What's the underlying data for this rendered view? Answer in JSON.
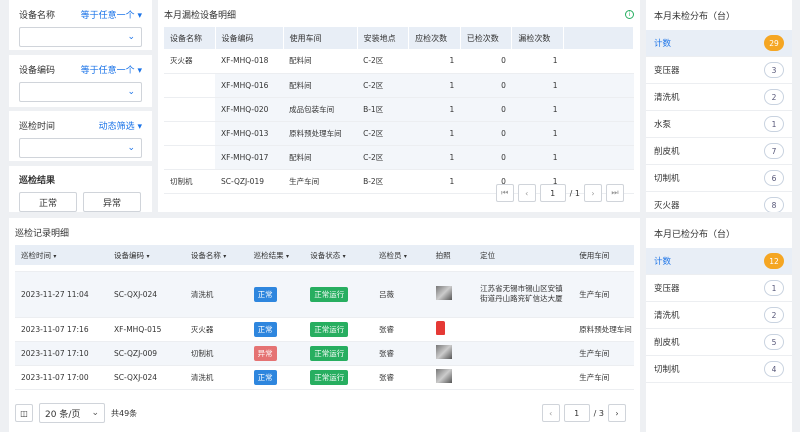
{
  "filters": {
    "equip_name": {
      "label": "设备名称",
      "mode": "等于任意一个"
    },
    "equip_code": {
      "label": "设备编码",
      "mode": "等于任意一个"
    },
    "inspect_time": {
      "label": "巡检时间",
      "mode": "动态筛选"
    },
    "result": {
      "label": "巡检结果",
      "normal": "正常",
      "abnormal": "异常"
    }
  },
  "missed": {
    "title": "本月漏检设备明细",
    "columns": [
      "设备名称",
      "设备编码",
      "使用车间",
      "安装地点",
      "应检次数",
      "已检次数",
      "漏检次数"
    ],
    "rows": [
      [
        "灭火器",
        "XF-MHQ-018",
        "配料间",
        "C-2区",
        "1",
        "0",
        "1"
      ],
      [
        "",
        "XF-MHQ-016",
        "配料间",
        "C-2区",
        "1",
        "0",
        "1"
      ],
      [
        "",
        "XF-MHQ-020",
        "成品包装车间",
        "B-1区",
        "1",
        "0",
        "1"
      ],
      [
        "",
        "XF-MHQ-013",
        "原料预处理车间",
        "C-2区",
        "1",
        "0",
        "1"
      ],
      [
        "",
        "XF-MHQ-017",
        "配料间",
        "C-2区",
        "1",
        "0",
        "1"
      ],
      [
        "切制机",
        "SC-QZJ-019",
        "生产车间",
        "B-2区",
        "1",
        "0",
        "1"
      ]
    ],
    "page": "1",
    "total_pages": "/ 1"
  },
  "unchecked": {
    "title": "本月未检分布（台）",
    "head": {
      "label": "计数",
      "value": "29"
    },
    "items": [
      {
        "label": "变压器",
        "value": "3"
      },
      {
        "label": "清洗机",
        "value": "2"
      },
      {
        "label": "水泵",
        "value": "1"
      },
      {
        "label": "削皮机",
        "value": "7"
      },
      {
        "label": "切制机",
        "value": "6"
      },
      {
        "label": "灭火器",
        "value": "8"
      }
    ]
  },
  "checked": {
    "title": "本月已检分布（台）",
    "head": {
      "label": "计数",
      "value": "12"
    },
    "items": [
      {
        "label": "变压器",
        "value": "1"
      },
      {
        "label": "清洗机",
        "value": "2"
      },
      {
        "label": "削皮机",
        "value": "5"
      },
      {
        "label": "切制机",
        "value": "4"
      }
    ]
  },
  "records": {
    "title": "巡检记录明细",
    "columns": [
      "巡检时间",
      "设备编码",
      "设备名称",
      "巡检结果",
      "设备状态",
      "巡检员",
      "拍照",
      "定位",
      "使用车间"
    ],
    "rows": [
      {
        "time": "2023-11-27 11:04",
        "code": "SC-QXJ-024",
        "name": "清洗机",
        "result": "正常",
        "status": "正常运行",
        "person": "吕薇",
        "loc": "江苏省无锡市锡山区安镇街道丹山路兖矿信达大厦",
        "ws": "生产车间"
      },
      {
        "time": "2023-11-07 17:16",
        "code": "XF-MHQ-015",
        "name": "灭火器",
        "result": "正常",
        "status": "正常运行",
        "person": "张睿",
        "loc": "",
        "ws": "原料预处理车间"
      },
      {
        "time": "2023-11-07 17:10",
        "code": "SC-QZJ-009",
        "name": "切制机",
        "result": "异常",
        "status": "正常运行",
        "person": "张睿",
        "loc": "",
        "ws": "生产车间"
      },
      {
        "time": "2023-11-07 17:00",
        "code": "SC-QXJ-024",
        "name": "清洗机",
        "result": "正常",
        "status": "正常运行",
        "person": "张睿",
        "loc": "",
        "ws": "生产车间"
      }
    ],
    "page_size": "20 条/页",
    "total": "共49条",
    "page": "1",
    "total_pages": "/ 3"
  },
  "colors": {
    "accent": "#1a73e8",
    "normal": "#2e86de",
    "running": "#27ae60",
    "abnormal": "#e57373",
    "badge_hot": "#f5a623"
  }
}
